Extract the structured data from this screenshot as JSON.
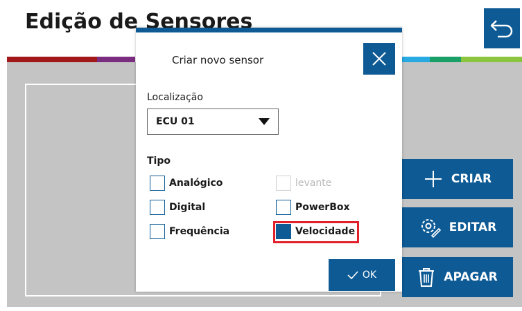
{
  "header": {
    "title": "Edição de Sensores"
  },
  "colors": {
    "accent": "#0d5a95",
    "highlight": "#e0202a",
    "background": "#c4c4c4",
    "stripe": [
      "#a3181a",
      "#c0202a",
      "#7b2d7f",
      "#27a9e1",
      "#1aa067",
      "#8bc43f"
    ]
  },
  "side_buttons": {
    "create_label": "CRIAR",
    "edit_label": "EDITAR",
    "delete_label": "APAGAR"
  },
  "dialog": {
    "title": "Criar novo sensor",
    "location_label": "Localização",
    "location_value": "ECU 01",
    "type_label": "Tipo",
    "types": {
      "analogico": "Analógico",
      "digital": "Digital",
      "frequencia": "Frequência",
      "levante": "levante",
      "powerbox": "PowerBox",
      "velocidade": "Velocidade"
    },
    "selected_type": "Velocidade",
    "ok_label": "OK"
  },
  "icons": {
    "back": "undo-arrow-icon",
    "close": "close-icon",
    "dropdown": "caret-down-icon",
    "create": "plus-icon",
    "edit": "gear-pencil-icon",
    "delete": "trash-icon",
    "ok": "check-icon"
  }
}
